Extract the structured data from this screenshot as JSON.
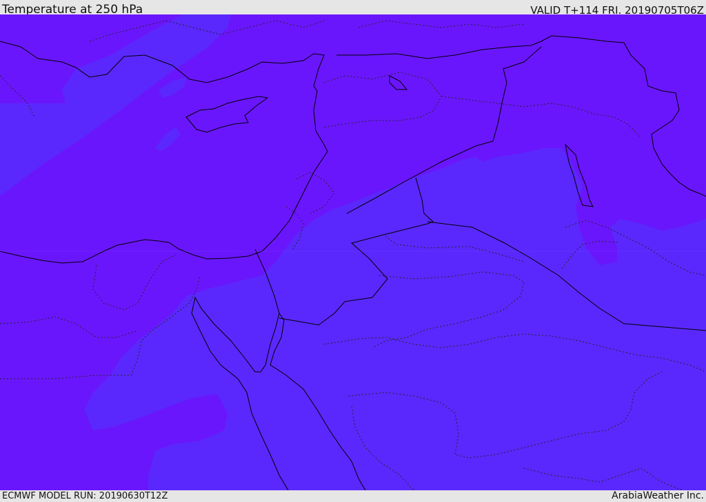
{
  "header": {
    "title": "Temperature at 250 hPa",
    "valid": "VALID T+114 FRI. 20190705T06Z"
  },
  "footer": {
    "model_run": "ECMWF MODEL RUN: 20190630T12Z",
    "credit": "ArabiaWeather Inc."
  },
  "map": {
    "shading": {
      "warmer_band": "#6a16fc",
      "cooler_band": "#5a28fc"
    },
    "coastline_color": "#000000",
    "border_style": "dotted"
  }
}
